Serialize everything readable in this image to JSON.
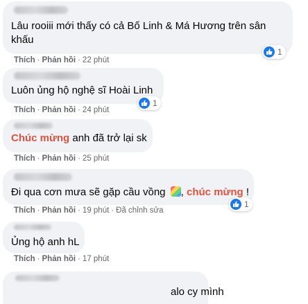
{
  "comments": [
    {
      "text": "Lâu rooiii mới thấy có cả Bố Linh & Má Hương trên sân",
      "text_line2": "khấu",
      "like": "Thích",
      "reply": "Phản hồi",
      "time": "22 phút",
      "reaction_count": "1"
    },
    {
      "text": "Luôn ủng hộ nghệ sĩ Hoài Linh",
      "like": "Thích",
      "reply": "Phản hồi",
      "time": "24 phút",
      "reaction_count": "1"
    },
    {
      "tag": "Chúc mừng",
      "text": " anh đã trở lại sk",
      "like": "Thích",
      "reply": "Phản hồi",
      "time": "25 phút"
    },
    {
      "text": "Đi qua cơn mưa sẽ gặp cầu vồng ",
      "tag": "chúc mừng",
      "text_end": " !",
      "emoji": "rainbow-emoji",
      "like": "Thích",
      "reply": "Phản hồi",
      "time": "19 phút",
      "edited": "Đã chỉnh sửa",
      "reaction_count": "1"
    },
    {
      "text": "Ủng hộ anh hL",
      "like": "Thích",
      "reply": "Phản hồi",
      "time": "17 phút"
    },
    {
      "text": "alo cy mình"
    }
  ],
  "icons": {
    "reaction": "like-icon"
  },
  "colors": {
    "bubble": "#f0f2f5",
    "tag": "#e0533f",
    "like_blue": "#1877f2",
    "meta": "#65676b"
  }
}
